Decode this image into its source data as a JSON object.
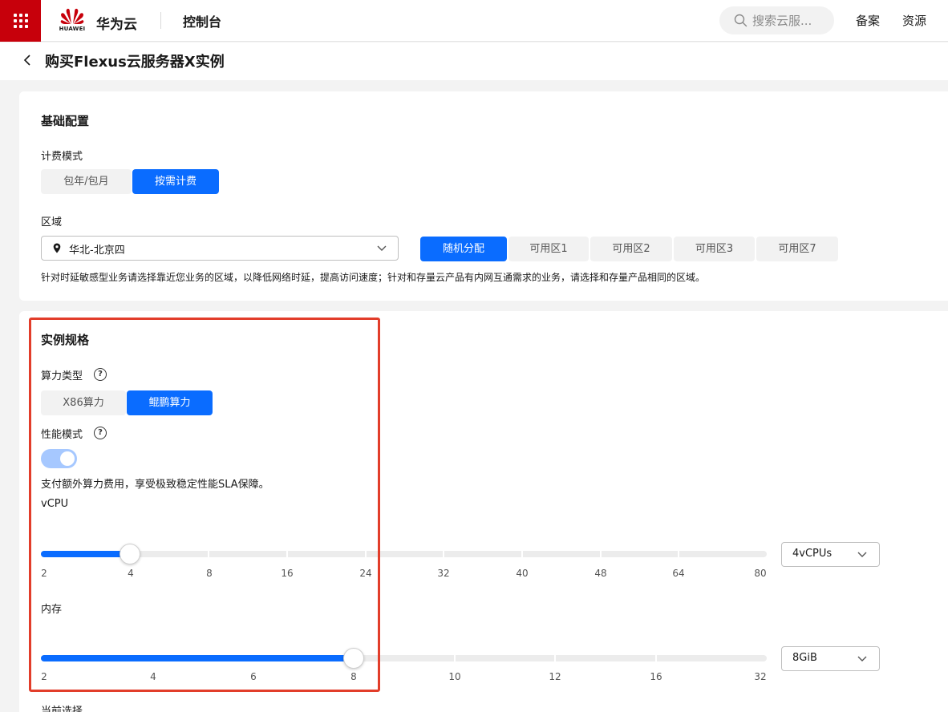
{
  "topbar": {
    "logo_text": "HUAWEI",
    "brand": "华为云",
    "console": "控制台",
    "search_placeholder": "搜索云服...",
    "links": [
      "备案",
      "资源"
    ]
  },
  "page": {
    "title": "购买Flexus云服务器X实例"
  },
  "basic": {
    "title": "基础配置",
    "billing_label": "计费模式",
    "billing_options": [
      "包年/包月",
      "按需计费"
    ],
    "billing_selected": "按需计费",
    "region_label": "区域",
    "region_value": "华北-北京四",
    "az_options": [
      "随机分配",
      "可用区1",
      "可用区2",
      "可用区3",
      "可用区7"
    ],
    "az_selected": "随机分配",
    "region_hint": "针对时延敏感型业务请选择靠近您业务的区域，以降低网络时延，提高访问速度；针对和存量云产品有内网互通需求的业务，请选择和存量产品相同的区域。"
  },
  "spec": {
    "title": "实例规格",
    "compute_label": "算力类型",
    "compute_options": [
      "X86算力",
      "鲲鹏算力"
    ],
    "compute_selected": "鲲鹏算力",
    "perf_label": "性能模式",
    "perf_enabled": true,
    "perf_hint": "支付额外算力费用，享受极致稳定性能SLA保障。",
    "vcpu": {
      "label": "vCPU",
      "ticks": [
        "2",
        "4",
        "8",
        "16",
        "24",
        "32",
        "40",
        "48",
        "64",
        "80"
      ],
      "selected_index": 1,
      "dropdown": "4vCPUs"
    },
    "memory": {
      "label": "内存",
      "ticks": [
        "2",
        "4",
        "6",
        "8",
        "10",
        "12",
        "16",
        "32"
      ],
      "selected_index": 3,
      "dropdown": "8GiB"
    },
    "current_selection_label": "当前选择"
  },
  "colors": {
    "brand_red": "#c7000b",
    "primary": "#0a6cff",
    "highlight": "#e23d2a"
  }
}
